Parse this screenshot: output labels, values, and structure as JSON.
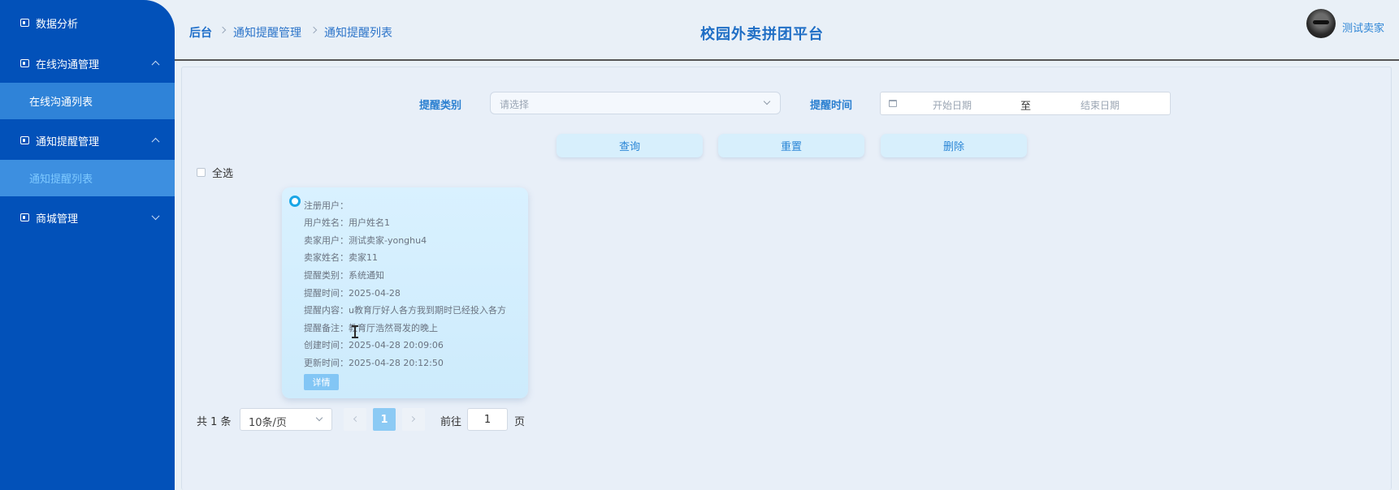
{
  "sidebar": {
    "menus": [
      {
        "label": "数据分析"
      },
      {
        "label": "在线沟通管理",
        "expanded": true
      },
      {
        "label": "通知提醒管理",
        "expanded": true
      },
      {
        "label": "商城管理",
        "expanded": false
      }
    ],
    "subitems": [
      {
        "label": "在线沟通列表"
      },
      {
        "label": "通知提醒列表",
        "active": true
      }
    ]
  },
  "header": {
    "breadcrumb": [
      "后台",
      "通知提醒管理",
      "通知提醒列表"
    ],
    "title": "校园外卖拼团平台",
    "user": "测试卖家"
  },
  "filters": {
    "category_label": "提醒类别",
    "category_placeholder": "请选择",
    "time_label": "提醒时间",
    "start_placeholder": "开始日期",
    "range_sep": "至",
    "end_placeholder": "结束日期"
  },
  "actions": {
    "query": "查询",
    "reset": "重置",
    "delete": "删除",
    "select_all": "全选"
  },
  "card": {
    "lines": [
      "注册用户：",
      "用户姓名：用户姓名1",
      "卖家用户：测试卖家-yonghu4",
      "卖家姓名：卖家11",
      "提醒类别：系统通知",
      "提醒时间：2025-04-28",
      "提醒内容：u教育厅好人各方我到期时已经投入各方",
      "提醒备注：教育厅浩然哥发的晚上",
      "创建时间：2025-04-28 20:09:06",
      "更新时间：2025-04-28 20:12:50"
    ],
    "detail_button": "详情"
  },
  "pagination": {
    "total": "共 1 条",
    "page_size": "10条/页",
    "current": "1",
    "goto_label": "前往",
    "goto_value": "1",
    "page_suffix": "页"
  },
  "colors": {
    "sidebar": "#0251b9",
    "accent": "#1f6ec5",
    "button_bg": "#d7effc"
  }
}
